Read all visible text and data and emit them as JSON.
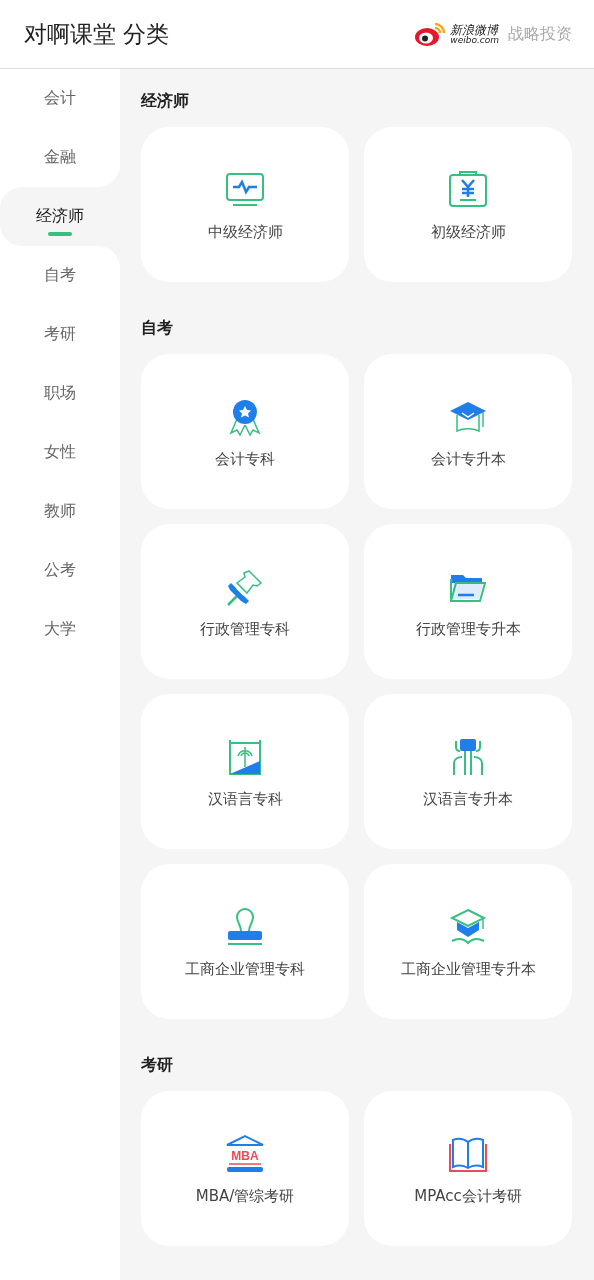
{
  "header": {
    "title": "对啊课堂 分类",
    "partner_logo": {
      "name": "新浪微博",
      "domain": "weibo.com"
    },
    "partner_label": "战略投资"
  },
  "sidebar": {
    "items": [
      {
        "label": "会计",
        "selected": false
      },
      {
        "label": "金融",
        "selected": false
      },
      {
        "label": "经济师",
        "selected": true
      },
      {
        "label": "自考",
        "selected": false
      },
      {
        "label": "考研",
        "selected": false
      },
      {
        "label": "职场",
        "selected": false
      },
      {
        "label": "女性",
        "selected": false
      },
      {
        "label": "教师",
        "selected": false
      },
      {
        "label": "公考",
        "selected": false
      },
      {
        "label": "大学",
        "selected": false
      }
    ]
  },
  "sections": [
    {
      "title": "经济师",
      "cards": [
        {
          "kind": "monitor",
          "label": "中级经济师"
        },
        {
          "kind": "yuan",
          "label": "初级经济师"
        }
      ]
    },
    {
      "title": "自考",
      "cards": [
        {
          "kind": "medal",
          "label": "会计专科"
        },
        {
          "kind": "cap",
          "label": "会计专升本"
        },
        {
          "kind": "pin",
          "label": "行政管理专科"
        },
        {
          "kind": "folder",
          "label": "行政管理专升本"
        },
        {
          "kind": "frame",
          "label": "汉语言专科"
        },
        {
          "kind": "glyph",
          "label": "汉语言专升本"
        },
        {
          "kind": "stamp",
          "label": "工商企业管理专科"
        },
        {
          "kind": "capbook",
          "label": "工商企业管理专升本"
        }
      ]
    },
    {
      "title": "考研",
      "cards": [
        {
          "kind": "mba",
          "icon_text": "MBA",
          "label": "MBA/管综考研"
        },
        {
          "kind": "book",
          "label": "MPAcc会计考研"
        }
      ]
    }
  ]
}
